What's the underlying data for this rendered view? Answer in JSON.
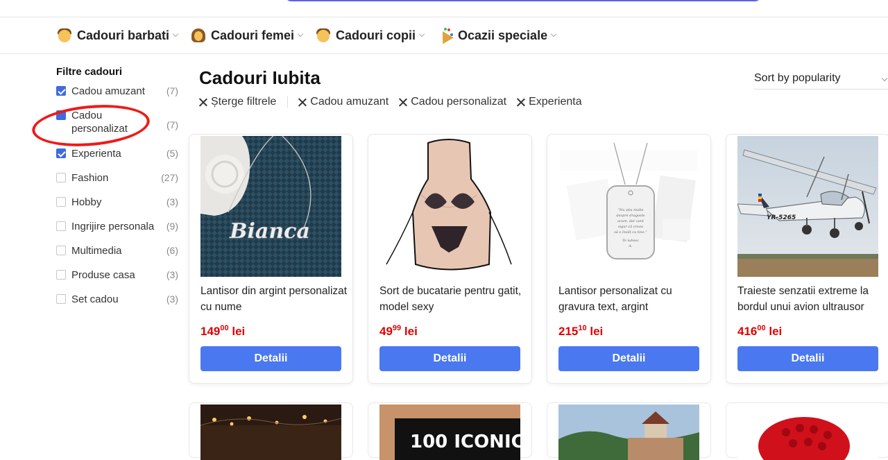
{
  "nav": {
    "items": [
      {
        "label": "Cadouri barbati",
        "icon": "man-icon"
      },
      {
        "label": "Cadouri femei",
        "icon": "woman-icon"
      },
      {
        "label": "Cadouri copii",
        "icon": "child-icon"
      },
      {
        "label": "Ocazii speciale",
        "icon": "party-popper-icon"
      }
    ]
  },
  "sidebar": {
    "title": "Filtre cadouri",
    "filters": [
      {
        "label": "Cadou amuzant",
        "count": "(7)",
        "checked": true
      },
      {
        "label": "Cadou personalizat",
        "count": "(7)",
        "checked": true
      },
      {
        "label": "Experienta",
        "count": "(5)",
        "checked": true
      },
      {
        "label": "Fashion",
        "count": "(27)",
        "checked": false
      },
      {
        "label": "Hobby",
        "count": "(3)",
        "checked": false
      },
      {
        "label": "Ingrijire personala",
        "count": "(9)",
        "checked": false
      },
      {
        "label": "Multimedia",
        "count": "(6)",
        "checked": false
      },
      {
        "label": "Produse casa",
        "count": "(3)",
        "checked": false
      },
      {
        "label": "Set cadou",
        "count": "(3)",
        "checked": false
      }
    ]
  },
  "main": {
    "title": "Cadouri Iubita",
    "sort_label": "Sort by popularity",
    "clear_filters": "Șterge filtrele",
    "active_filters": [
      "Cadou amuzant",
      "Cadou personalizat",
      "Experienta"
    ]
  },
  "products": [
    {
      "name": "Lantisor din argint personalizat cu nume",
      "price_int": "149",
      "price_dec": "00",
      "currency": "lei",
      "button": "Detalii",
      "image_text": "Bianca"
    },
    {
      "name": "Sort de bucatarie pentru gatit, model sexy",
      "price_int": "49",
      "price_dec": "99",
      "currency": "lei",
      "button": "Detalii"
    },
    {
      "name": "Lantisor personalizat cu gravura text, argint",
      "price_int": "215",
      "price_dec": "10",
      "currency": "lei",
      "button": "Detalii"
    },
    {
      "name": "Traieste senzatii extreme la bordul unui avion ultrausor",
      "price_int": "416",
      "price_dec": "00",
      "currency": "lei",
      "button": "Detalii",
      "image_text": "YR-5265"
    }
  ],
  "second_row": {
    "book_text": "100 ICONIC"
  },
  "colors": {
    "accent_button": "#4a78f0",
    "price_red": "#e00000",
    "checkbox_blue": "#3f6be0",
    "annotation_red": "#ee1a1a"
  }
}
